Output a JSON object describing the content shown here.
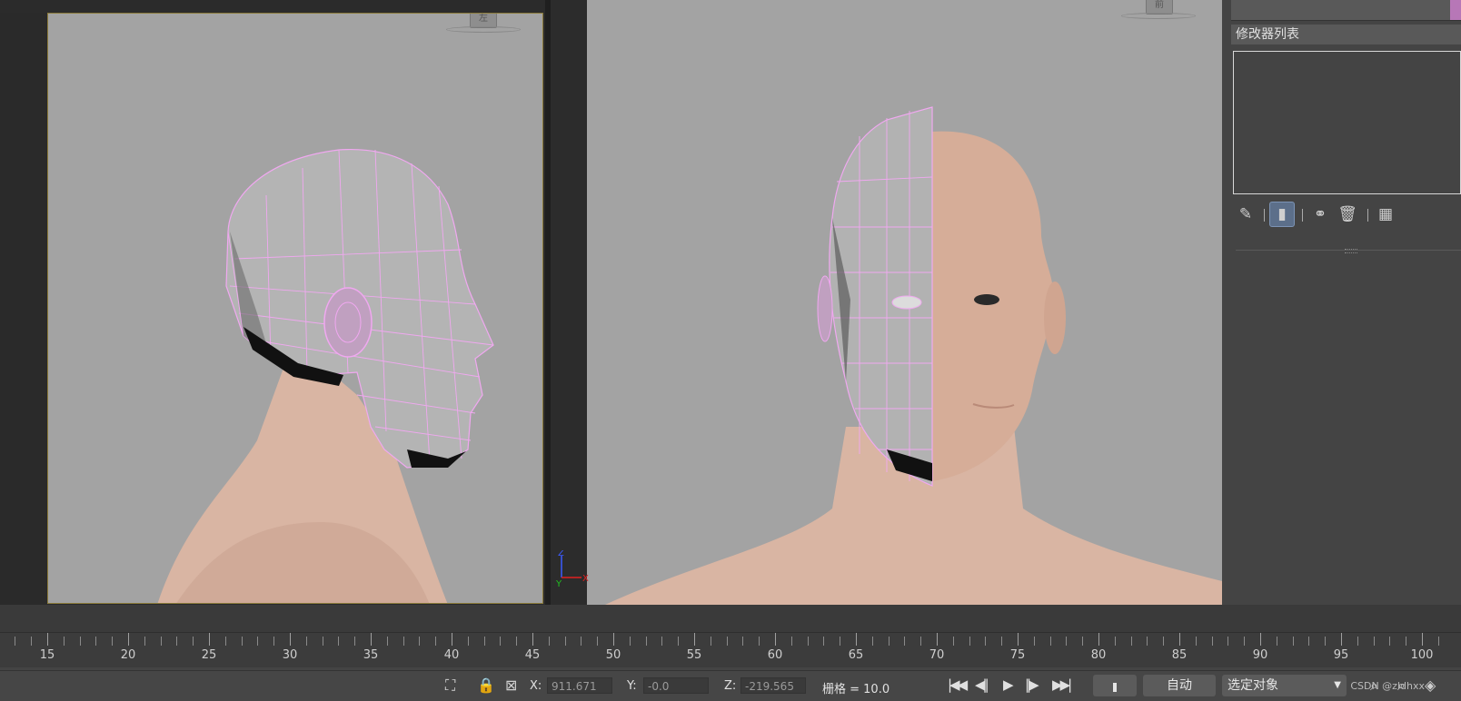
{
  "viewports": {
    "left": {
      "cube_label": "左"
    },
    "right": {
      "cube_label": "前",
      "axes": {
        "z": "Z",
        "x": "X",
        "y": "Y"
      }
    }
  },
  "command_panel": {
    "modifier_list_label": "修改器列表",
    "stack_tools": [
      {
        "name": "pin-stack-icon",
        "glyph": "✎"
      },
      {
        "name": "show-end-result-icon",
        "glyph": "▮"
      },
      {
        "name": "make-unique-icon",
        "glyph": "⛬"
      },
      {
        "name": "remove-modifier-icon",
        "glyph": "🗑"
      },
      {
        "name": "configure-modifier-sets-icon",
        "glyph": "▦"
      }
    ]
  },
  "timeline": {
    "tick_labels": [
      "15",
      "20",
      "25",
      "30",
      "35",
      "40",
      "45",
      "50",
      "55",
      "60",
      "65",
      "70",
      "75",
      "80",
      "85",
      "90",
      "95",
      "100"
    ]
  },
  "statusbar": {
    "x_label": "X:",
    "x_value": "911.671",
    "y_label": "Y:",
    "y_value": "-0.0",
    "z_label": "Z:",
    "z_value": "-219.565",
    "grid_text": "栅格 = 10.0",
    "auto_key_label": "自动",
    "selection_filter": "选定对象",
    "watermark": "CSDN @zldhxx"
  },
  "colors": {
    "viewport_bg": "#a3a3a3",
    "wire_color": "#f0a8f0",
    "skin": "#d9b5a3",
    "active_viewport_border": "#8a7a3a"
  }
}
